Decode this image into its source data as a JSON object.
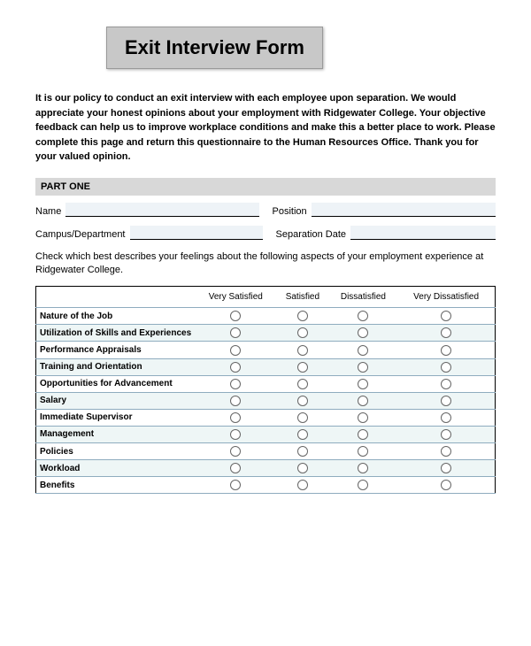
{
  "title": "Exit Interview Form",
  "intro": "It is our policy to conduct an exit interview with each employee upon separation. We would appreciate your honest opinions about your employment with Ridgewater College. Your objective feedback can help us to improve workplace conditions and make this a better place to work. Please complete this page and return this questionnaire to the Human Resources Office. Thank you for your valued opinion.",
  "partHeader": "PART ONE",
  "fields": {
    "name_label": "Name",
    "position_label": "Position",
    "campus_label": "Campus/Department",
    "separation_label": "Separation Date"
  },
  "instructions": "Check which best describes your feelings about the following aspects of your employment experience at Ridgewater College.",
  "columns": {
    "c1": "Very Satisfied",
    "c2": "Satisfied",
    "c3": "Dissatisfied",
    "c4": "Very Dissatisfied"
  },
  "rows": {
    "r0": "Nature of the Job",
    "r1": "Utilization of Skills and Experiences",
    "r2": "Performance Appraisals",
    "r3": "Training and Orientation",
    "r4": "Opportunities for Advancement",
    "r5": "Salary",
    "r6": "Immediate Supervisor",
    "r7": "Management",
    "r8": "Policies",
    "r9": "Workload",
    "r10": "Benefits"
  }
}
